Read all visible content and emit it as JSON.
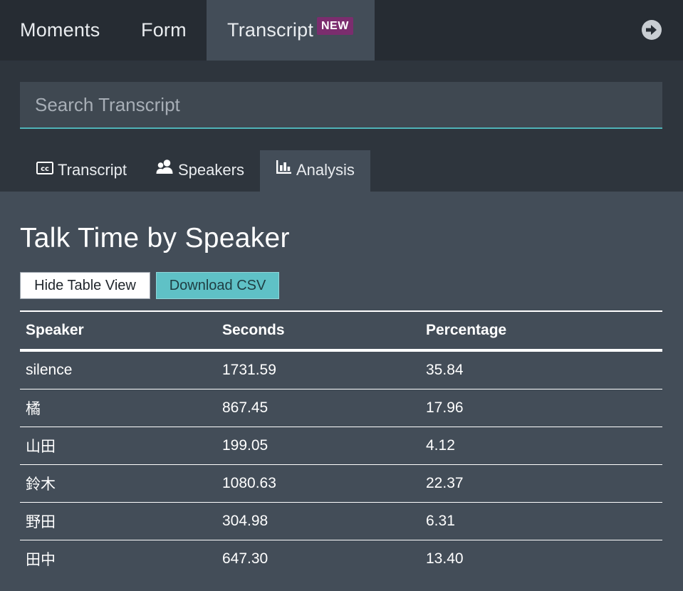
{
  "top_tabs": {
    "moments": "Moments",
    "form": "Form",
    "transcript": "Transcript",
    "new_badge": "NEW"
  },
  "icons": {
    "next": "arrow-right-circle-icon",
    "transcript_tab": "closed-captions-icon",
    "speakers_tab": "people-icon",
    "analysis_tab": "bar-chart-icon"
  },
  "search": {
    "placeholder": "Search Transcript"
  },
  "sub_tabs": {
    "transcript": "Transcript",
    "speakers": "Speakers",
    "analysis": "Analysis",
    "active": "Analysis"
  },
  "analysis": {
    "title": "Talk Time by Speaker",
    "hide_table_label": "Hide Table View",
    "download_csv_label": "Download CSV",
    "columns": [
      "Speaker",
      "Seconds",
      "Percentage"
    ],
    "rows": [
      [
        "silence",
        "1731.59",
        "35.84"
      ],
      [
        "橘",
        "867.45",
        "17.96"
      ],
      [
        "山田",
        "199.05",
        "4.12"
      ],
      [
        "鈴木",
        "1080.63",
        "22.37"
      ],
      [
        "野田",
        "304.98",
        "6.31"
      ],
      [
        "田中",
        "647.30",
        "13.40"
      ]
    ]
  },
  "colors": {
    "accent": "#5fc1c6",
    "badge": "#7b2d6e",
    "panel": "#434d58",
    "nav": "#262c33"
  }
}
